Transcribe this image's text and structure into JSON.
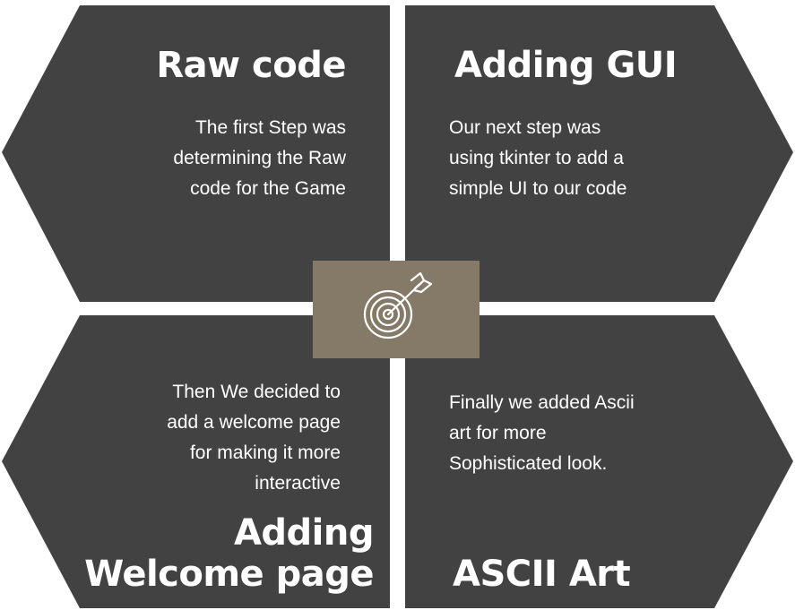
{
  "colors": {
    "panel": "#434242",
    "center": "#857967",
    "text": "#ffffff"
  },
  "quadrants": [
    {
      "title": "Raw code",
      "lines": [
        "The first Step was",
        "determining the Raw",
        "code for the Game"
      ]
    },
    {
      "title": "Adding GUI",
      "lines": [
        "Our next step was",
        "using tkinter to add a",
        "simple UI to our code"
      ]
    },
    {
      "title_lines": [
        "Adding",
        "Welcome page"
      ],
      "lines": [
        "Then We decided to",
        "add a welcome page",
        "for making it more",
        "interactive"
      ]
    },
    {
      "title": "ASCII Art",
      "lines": [
        "Finally we added Ascii",
        "art for more",
        "Sophisticated look."
      ]
    }
  ],
  "center_icon": "target-arrow-icon"
}
